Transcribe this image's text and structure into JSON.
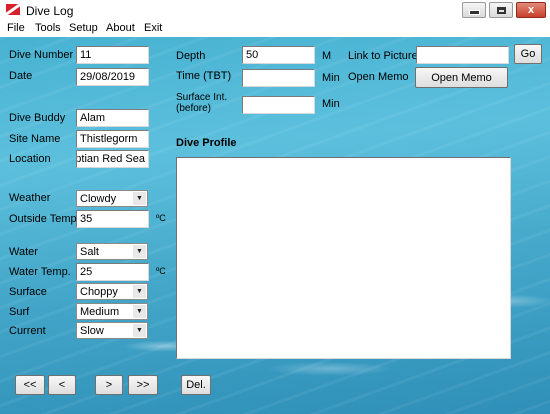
{
  "window": {
    "title": "Dive Log",
    "close_glyph": "x"
  },
  "menu": [
    "File",
    "Tools",
    "Setup",
    "About",
    "Exit"
  ],
  "left": {
    "dive_number": {
      "label": "Dive Number",
      "value": "11"
    },
    "date": {
      "label": "Date",
      "value": "29/08/2019"
    },
    "dive_buddy": {
      "label": "Dive Buddy",
      "value": "Alam"
    },
    "site_name": {
      "label": "Site Name",
      "value": "Thistlegorm"
    },
    "location": {
      "label": "Location",
      "value": "Egyptian Red Sea"
    },
    "weather": {
      "label": "Weather",
      "value": "Clowdy"
    },
    "outside_temp": {
      "label": "Outside Temp.",
      "value": "35",
      "unit": "ºC"
    },
    "water": {
      "label": "Water",
      "value": "Salt"
    },
    "water_temp": {
      "label": "Water Temp.",
      "value": "25",
      "unit": "ºC"
    },
    "surface": {
      "label": "Surface",
      "value": "Choppy"
    },
    "surf": {
      "label": "Surf",
      "value": "Medium"
    },
    "current": {
      "label": "Current",
      "value": "Slow"
    }
  },
  "middle": {
    "depth": {
      "label": "Depth",
      "value": "50",
      "unit": "M"
    },
    "time": {
      "label": "Time (TBT)",
      "value": "",
      "unit": "Min"
    },
    "surface_int": {
      "label_line1": "Surface Int.",
      "label_line2": "(before)",
      "value": "",
      "unit": "Min"
    },
    "dive_profile_label": "Dive Profile"
  },
  "right": {
    "link_label": "Link to Pictures",
    "link_value": "",
    "go_button": "Go",
    "memo_label": "Open Memo",
    "memo_button": "Open Memo"
  },
  "nav": {
    "first": "<<",
    "prev": "<",
    "next": ">",
    "last": ">>",
    "delete": "Del."
  }
}
